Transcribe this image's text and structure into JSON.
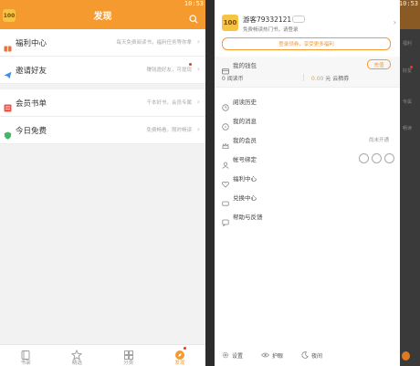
{
  "left": {
    "status_time": "10:53",
    "title": "发现",
    "logo_text": "100",
    "rows": [
      {
        "name": "福利中心",
        "desc": "每天免费阅读书，福利任务等你拿",
        "dot": false
      },
      {
        "name": "邀请好友",
        "desc": "赚钱邀好友，可提现",
        "dot": true
      },
      {
        "name": "会员书单",
        "desc": "千本好书，会员专属",
        "dot": false
      },
      {
        "name": "今日免费",
        "desc": "免费畅看，限时畅读",
        "dot": false
      }
    ],
    "tabs": [
      {
        "label": "书架"
      },
      {
        "label": "精选"
      },
      {
        "label": "分类"
      },
      {
        "label": "发现"
      }
    ]
  },
  "right": {
    "status_time": "10:53",
    "avatar_text": "100",
    "username": "游客79332121",
    "user_sub": "免费畅读热门书，请登录",
    "login_button": "登录领券，享受更多福利",
    "account_label": "我的钱包",
    "recharge_button": "充值",
    "coins": "0 阅读币",
    "voucher_num": "0.00",
    "voucher_text": "元 云栖券",
    "menu": [
      {
        "label": "阅读历史",
        "right": ""
      },
      {
        "label": "我的消息",
        "right": ""
      },
      {
        "label": "我的会员",
        "right": "尚未开通"
      },
      {
        "label": "帐号绑定",
        "right": ""
      },
      {
        "label": "福利中心",
        "right": ""
      },
      {
        "label": "兑换中心",
        "right": ""
      },
      {
        "label": "帮助与反馈",
        "right": ""
      }
    ],
    "footer": [
      {
        "label": "设置"
      },
      {
        "label": "护眼"
      },
      {
        "label": "夜间"
      }
    ],
    "peek": [
      "福利",
      "好友",
      "专属",
      "畅读"
    ]
  },
  "colors": {
    "accent": "#f59a2e",
    "badge": "#e8372c"
  }
}
